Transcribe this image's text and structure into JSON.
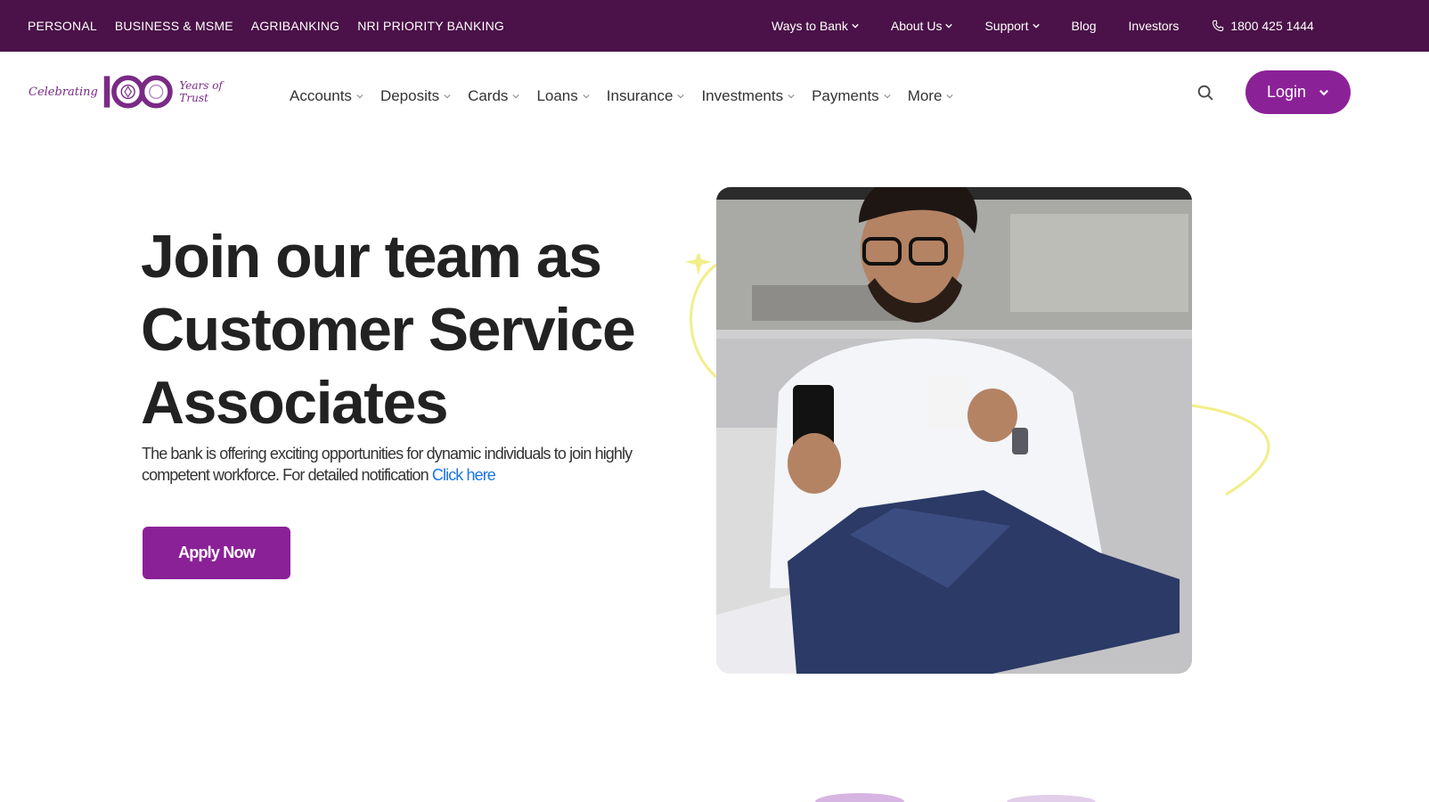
{
  "topbar": {
    "segments": [
      "PERSONAL",
      "BUSINESS & MSME",
      "AGRIBANKING",
      "NRI PRIORITY BANKING"
    ],
    "links": [
      {
        "label": "Ways to Bank",
        "dropdown": true
      },
      {
        "label": "About Us",
        "dropdown": true
      },
      {
        "label": "Support",
        "dropdown": true
      },
      {
        "label": "Blog",
        "dropdown": false
      },
      {
        "label": "Investors",
        "dropdown": false
      }
    ],
    "phone": "1800 425 1444"
  },
  "logo": {
    "celebrating": "Celebrating",
    "number": "100",
    "years": "Years of Trust"
  },
  "nav": {
    "items": [
      "Accounts",
      "Deposits",
      "Cards",
      "Loans",
      "Insurance",
      "Investments",
      "Payments",
      "More"
    ],
    "login_label": "Login"
  },
  "hero": {
    "title_line1": "Join our team as",
    "title_line2": "Customer Service",
    "title_line3": "Associates",
    "desc_text": "The bank is offering exciting opportunities for dynamic individuals to join highly competent workforce. For detailed notification ",
    "desc_link": "Click here",
    "apply_label": "Apply Now"
  },
  "colors": {
    "topbar_bg": "#4a1248",
    "brand_purple": "#8b2197",
    "link_blue": "#1a73e8",
    "deco_yellow": "#f2ee8a"
  }
}
